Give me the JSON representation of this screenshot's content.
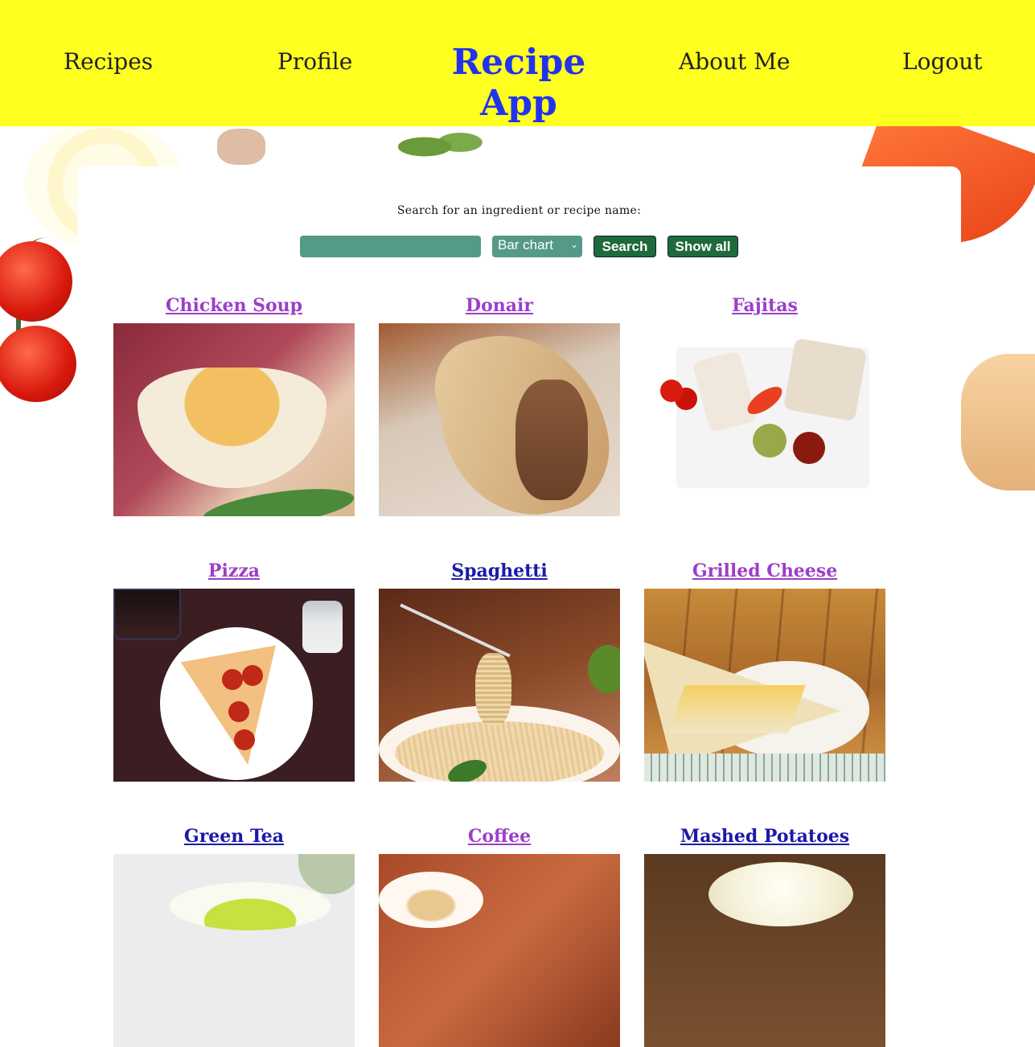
{
  "header": {
    "nav_left": [
      "Recipes",
      "Profile"
    ],
    "title": "Recipe App",
    "nav_right": [
      "About Me",
      "Logout"
    ]
  },
  "search": {
    "label": "Search for an ingredient or recipe name:",
    "input_value": "",
    "chart_select_value": "Bar chart",
    "search_button": "Search",
    "show_all_button": "Show all"
  },
  "recipes": [
    {
      "name": "Chicken Soup",
      "visited": true
    },
    {
      "name": "Donair",
      "visited": true
    },
    {
      "name": "Fajitas",
      "visited": true
    },
    {
      "name": "Pizza",
      "visited": true
    },
    {
      "name": "Spaghetti",
      "visited": false
    },
    {
      "name": "Grilled Cheese",
      "visited": true
    },
    {
      "name": "Green Tea",
      "visited": false
    },
    {
      "name": "Coffee",
      "visited": true
    },
    {
      "name": "Mashed Potatoes",
      "visited": false
    }
  ],
  "colors": {
    "header_bg": "#ffff1f",
    "title": "#2233ee",
    "visited_link": "#9b3fc8",
    "unvisited_link": "#1a1aa8",
    "input_bg": "#559988",
    "button_bg": "#1f6a3d"
  }
}
